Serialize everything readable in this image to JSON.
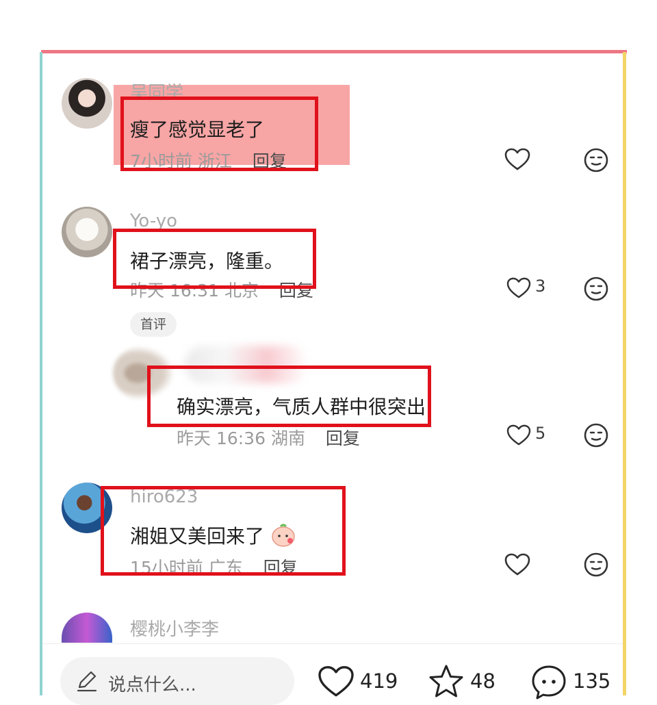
{
  "comments": [
    {
      "username": "吴同学",
      "text": "瘦了感觉显老了",
      "time": "7小时前",
      "location": "浙江",
      "reply": "回复",
      "likes": ""
    },
    {
      "username": "Yo-yo",
      "text": "裙子漂亮，隆重。",
      "time": "昨天 16:31",
      "location": "北京",
      "reply": "回复",
      "likes": "3",
      "badge": "首评",
      "sub_reply": {
        "text": "确实漂亮，气质人群中很突出",
        "time": "昨天 16:36",
        "location": "湖南",
        "reply": "回复",
        "likes": "5"
      }
    },
    {
      "username": "hiro623",
      "text": "湘姐又美回来了",
      "time": "15小时前",
      "location": "广东",
      "reply": "回复",
      "likes": ""
    },
    {
      "username": "樱桃小李李"
    }
  ],
  "bottom_bar": {
    "input_placeholder": "说点什么...",
    "like_count": "419",
    "favorite_count": "48",
    "comment_count": "135"
  },
  "colors": {
    "highlight_red": "#e0111b",
    "frame_top": "#ee7683",
    "frame_left": "#8fd3cf",
    "frame_right": "#f3d567"
  },
  "icons": [
    "heart-icon",
    "emoji-icon",
    "pencil-icon",
    "star-icon",
    "comment-bubble-icon",
    "emoji-sticker-icon"
  ]
}
